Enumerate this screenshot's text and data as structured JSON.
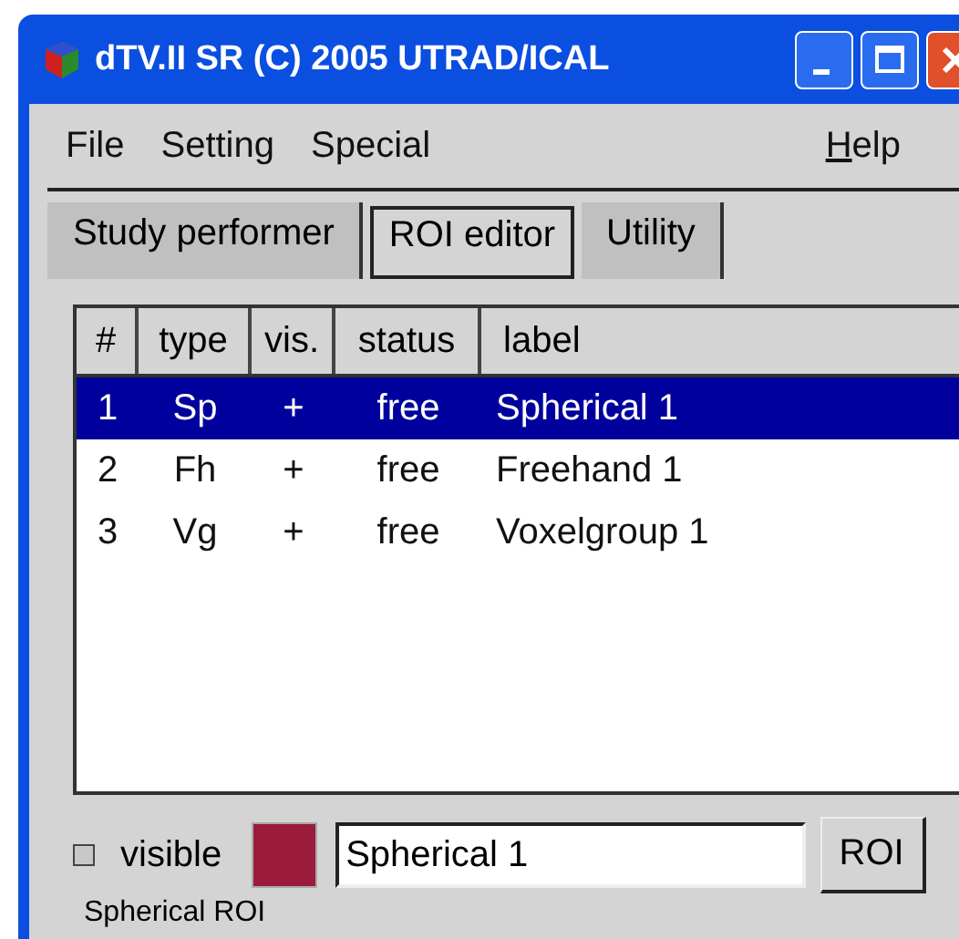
{
  "window": {
    "title": "dTV.II SR (C) 2005 UTRAD/ICAL"
  },
  "menu": [
    {
      "label": "File",
      "mnemonic": false
    },
    {
      "label": "Setting",
      "mnemonic": false
    },
    {
      "label": "Special",
      "mnemonic": false
    },
    {
      "label": "Help",
      "mnemonic": true
    }
  ],
  "tabs": [
    {
      "label": "Study performer",
      "selected": false
    },
    {
      "label": "ROI editor",
      "selected": true
    },
    {
      "label": "Utility",
      "selected": false
    }
  ],
  "table": {
    "columns": [
      "#",
      "type",
      "vis.",
      "status",
      "label"
    ],
    "rows": [
      {
        "cells": [
          "1",
          "Sp",
          "+",
          "free",
          "Spherical 1"
        ],
        "selected": true
      },
      {
        "cells": [
          "2",
          "Fh",
          "+",
          "free",
          "Freehand 1"
        ],
        "selected": false
      },
      {
        "cells": [
          "3",
          "Vg",
          "+",
          "free",
          "Voxelgroup 1"
        ],
        "selected": false
      }
    ]
  },
  "editor": {
    "visible_label": "visible",
    "visible_checked": false,
    "color": "#9b1c3a",
    "name_value": "Spherical 1",
    "button": "ROI"
  },
  "footer_text": "Spherical ROI"
}
